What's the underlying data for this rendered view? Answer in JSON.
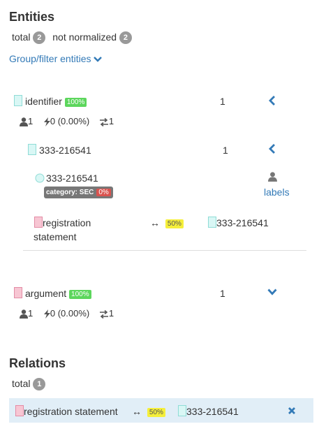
{
  "entities": {
    "title": "Entities",
    "total_label": "total",
    "total_count": "2",
    "not_normalized_label": "not normalized",
    "not_normalized_count": "2",
    "group_filter_link": "Group/filter entities"
  },
  "entity_identifier": {
    "name": "identifier",
    "percent": "100%",
    "count": "1",
    "stats": {
      "users": "1",
      "bolt": "0 (0.00%)",
      "relations": "1"
    },
    "child": {
      "name": "333-216541",
      "count": "1",
      "mention": {
        "text": "333-216541",
        "category_label": "category: SEC",
        "category_percent": "0%",
        "labels_link": "labels"
      },
      "relation": {
        "left_line1": "registration",
        "left_line2": "statement",
        "arrow": "↔",
        "percent": "50%",
        "right": "333-216541"
      }
    }
  },
  "entity_argument": {
    "name": "argument",
    "percent": "100%",
    "count": "1",
    "stats": {
      "users": "1",
      "bolt": "0 (0.00%)",
      "relations": "1"
    }
  },
  "relations": {
    "title": "Relations",
    "total_label": "total",
    "total_count": "1",
    "row": {
      "left": "registration statement",
      "arrow": "↔",
      "percent": "50%",
      "right": "333-216541"
    }
  },
  "colors": {
    "link": "#337ab7",
    "cyan_swatch": "#d9f7f5",
    "pink_swatch": "#f7c6d3",
    "relation_row_bg": "#e1eef7"
  },
  "icons": [
    "chevron-down-icon",
    "chevron-left-icon",
    "user-icon",
    "bolt-icon",
    "exchange-icon",
    "circle-icon",
    "close-icon"
  ]
}
